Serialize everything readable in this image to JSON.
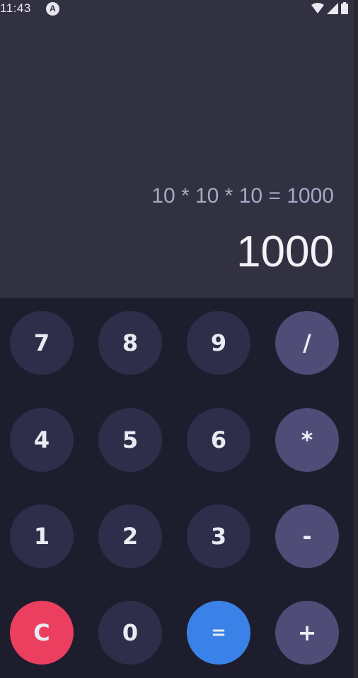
{
  "status_bar": {
    "time": "11:43",
    "app_icon_glyph": "A",
    "icons": [
      "wifi-icon",
      "signal-icon",
      "battery-icon"
    ]
  },
  "display": {
    "expression": "10 * 10 * 10 = 1000",
    "result": "1000"
  },
  "keys": {
    "k7": "7",
    "k8": "8",
    "k9": "9",
    "divide": "/",
    "k4": "4",
    "k5": "5",
    "k6": "6",
    "multiply": "*",
    "k1": "1",
    "k2": "2",
    "k3": "3",
    "subtract": "-",
    "clear": "C",
    "k0": "0",
    "equals": "=",
    "add": "+"
  },
  "colors": {
    "display_bg": "#323142",
    "keypad_bg": "#1e1d2e",
    "number_key": "#2f2e4a",
    "operator_key": "#4f4c78",
    "clear_key": "#ec3f5f",
    "equals_key": "#3b82e8"
  }
}
